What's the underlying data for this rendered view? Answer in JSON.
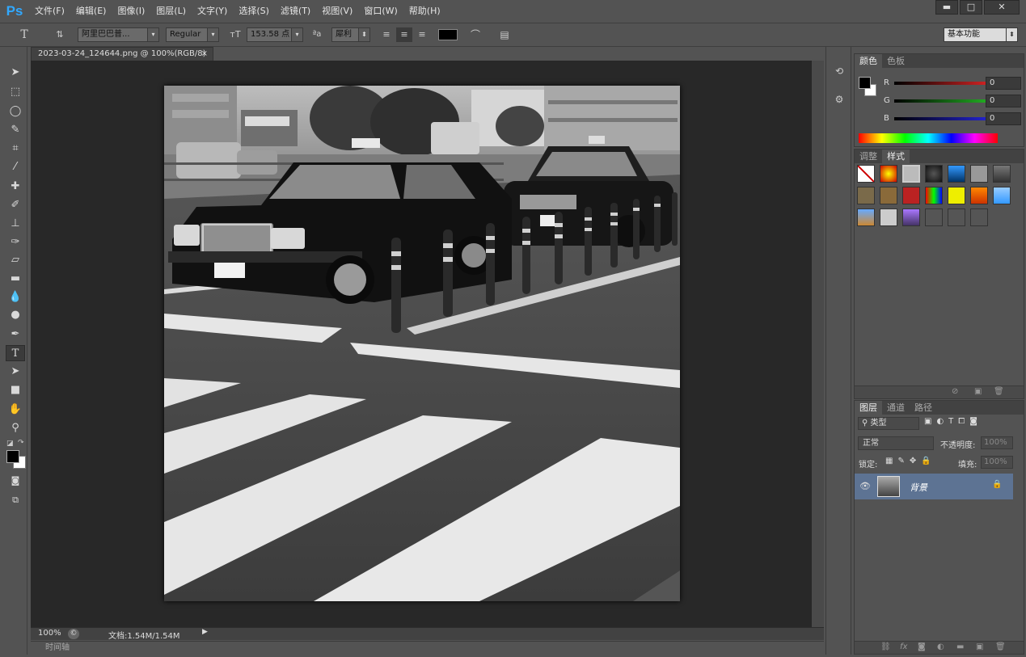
{
  "app": {
    "logo": "Ps"
  },
  "menu": [
    "文件(F)",
    "编辑(E)",
    "图像(I)",
    "图层(L)",
    "文字(Y)",
    "选择(S)",
    "滤镜(T)",
    "视图(V)",
    "窗口(W)",
    "帮助(H)"
  ],
  "window_controls": {
    "minimize": "▬",
    "maximize": "□",
    "close": "✕"
  },
  "options": {
    "tool_icon": "T",
    "font_family": "阿里巴巴普...",
    "font_style": "Regular",
    "font_size": "153.58 点",
    "aa_label": "ªa",
    "antialias": "犀利",
    "workspace": "基本功能"
  },
  "document": {
    "tab_title": "2023-03-24_124644.png @ 100%(RGB/8)",
    "tab_close": "×",
    "zoom": "100%",
    "doc_info": "文档:1.54M/1.54M",
    "timeline_label": "时间轴"
  },
  "color_panel": {
    "tabs": [
      "颜色",
      "色板"
    ],
    "channels": [
      {
        "label": "R",
        "value": "0",
        "color": "#cc2222"
      },
      {
        "label": "G",
        "value": "0",
        "color": "#22aa22"
      },
      {
        "label": "B",
        "value": "0",
        "color": "#2222cc"
      }
    ]
  },
  "adjust_panel": {
    "tabs": [
      "调整",
      "样式"
    ]
  },
  "layers_panel": {
    "tabs": [
      "图层",
      "通道",
      "路径"
    ],
    "filter_kind": "类型",
    "blend_mode": "正常",
    "opacity_label": "不透明度:",
    "opacity_value": "100%",
    "lock_label": "锁定:",
    "fill_label": "填充:",
    "fill_value": "100%",
    "layers": [
      {
        "name": "背景",
        "visible": true,
        "locked": true
      }
    ]
  },
  "colors": {
    "accent": "#31a8ff",
    "selected_layer": "#5d7393",
    "canvas_bg": "#282828",
    "panel_bg": "#535353"
  }
}
